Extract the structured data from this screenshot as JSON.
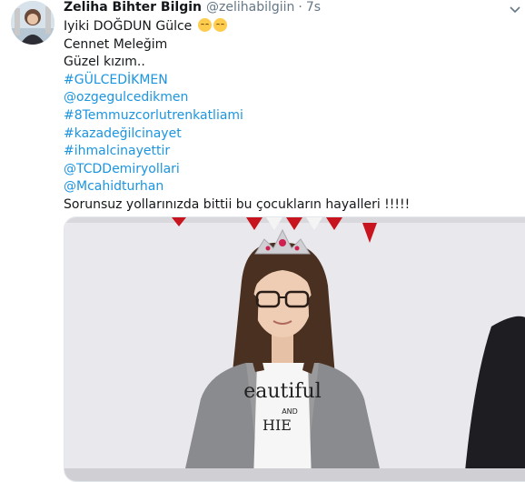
{
  "tweet": {
    "display_name": "Zeliha Bihter Bilgin",
    "handle": "@zelihabilgiin",
    "separator": "·",
    "time": "7s",
    "lines": [
      {
        "text": "Iyiki DOĞDUN Gülce",
        "type": "text",
        "emoji": [
          "pensive-face",
          "pensive-face"
        ]
      },
      {
        "text": "Cennet Meleğim",
        "type": "text"
      },
      {
        "text": "Güzel kızım..",
        "type": "text"
      },
      {
        "text": "#GÜLCEDİKMEN",
        "type": "link"
      },
      {
        "text": "@ozgegulcedikmen",
        "type": "link"
      },
      {
        "text": "#8Temmuzcorlutrenkatliami",
        "type": "link"
      },
      {
        "text": "#kazadeğilcinayet",
        "type": "link"
      },
      {
        "text": "#ihmalcinayettir",
        "type": "link"
      },
      {
        "text": "@TCDDemiryollari",
        "type": "link"
      },
      {
        "text": "@Mcahidturhan",
        "type": "link"
      },
      {
        "text": "Sorunsuz yollarınızda bittii bu çocukların hayalleri !!!!!",
        "type": "text"
      }
    ],
    "media_text": {
      "shirt_line1": "eautiful",
      "shirt_line2": "AND",
      "shirt_line3": "HIE"
    }
  },
  "colors": {
    "link": "#1b95e0",
    "secondary": "#657786",
    "primary_text": "#14171a"
  },
  "icons": {
    "menu": "chevron-down-icon",
    "emoji": "pensive-face-emoji"
  }
}
